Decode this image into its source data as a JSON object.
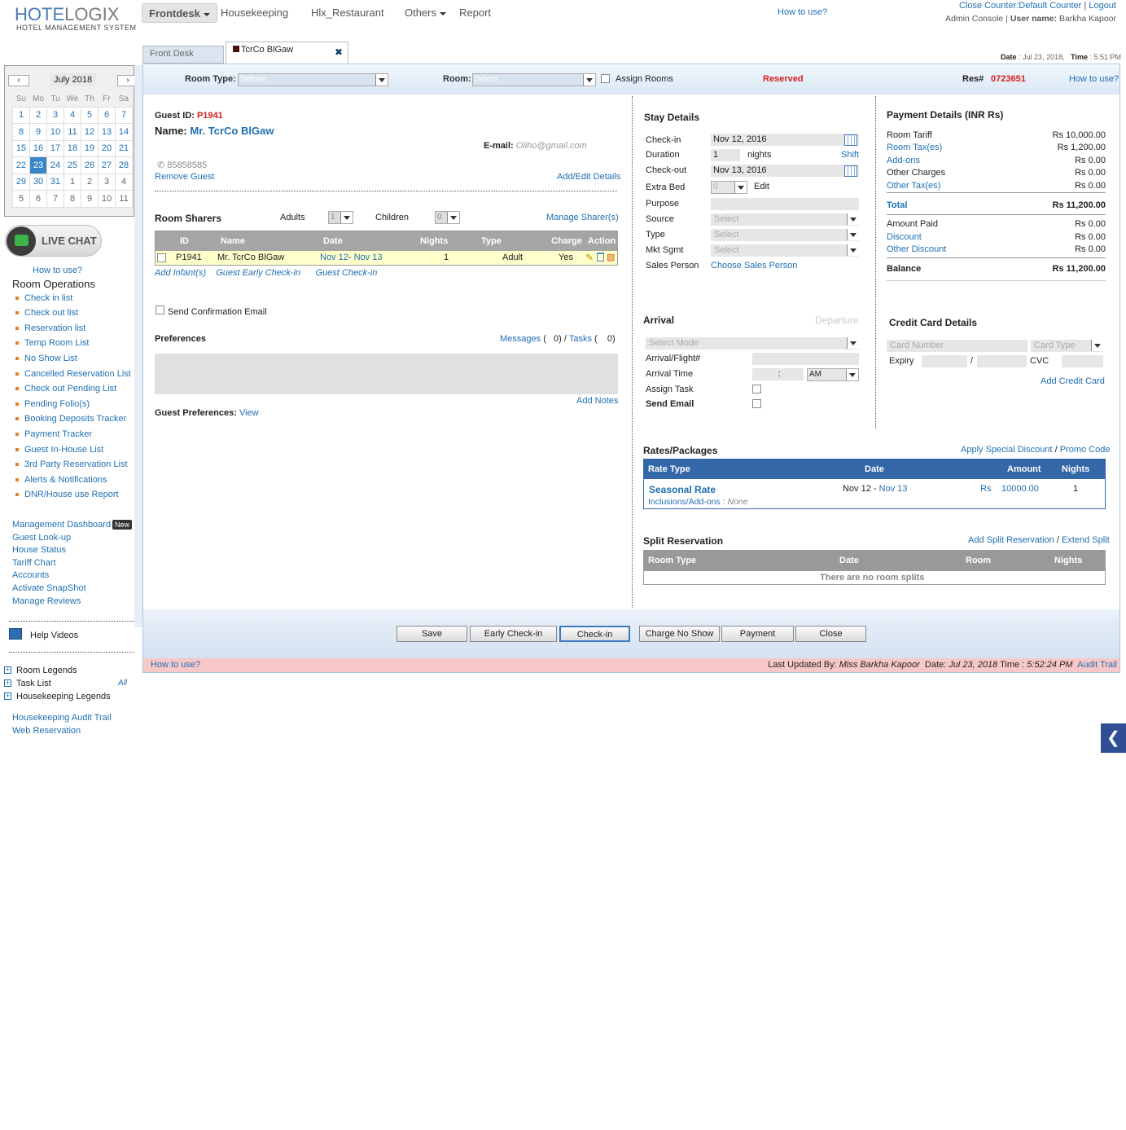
{
  "header": {
    "logo_main": "HOTELOGIX",
    "logo_a": "HOTE",
    "logo_b": "LOGIX",
    "logo_sub": "HOTEL MANAGEMENT SYSTEM",
    "nav": [
      "Frontdesk",
      "Housekeeping",
      "Hlx_Restaurant",
      "Others",
      "Report"
    ],
    "how_to_use": "How to use?",
    "close_counter": "Close Counter:Default Counter",
    "logout": "Logout",
    "admin_console": "Admin Console",
    "user_label": "User name:",
    "user_name": "Barkha Kapoor",
    "date_label": "Date",
    "date_value": ": Jul 23, 2018,",
    "time_label": "Time",
    "time_value": ": 5:51:PM"
  },
  "calendar": {
    "month": "July 2018",
    "days": [
      "Su",
      "Mo",
      "Tu",
      "We",
      "Th",
      "Fr",
      "Sa"
    ],
    "weeks": [
      [
        "1",
        "2",
        "3",
        "4",
        "5",
        "6",
        "7"
      ],
      [
        "8",
        "9",
        "10",
        "11",
        "12",
        "13",
        "14"
      ],
      [
        "15",
        "16",
        "17",
        "18",
        "19",
        "20",
        "21"
      ],
      [
        "22",
        "23",
        "24",
        "25",
        "26",
        "27",
        "28"
      ],
      [
        "29",
        "30",
        "31",
        "1",
        "2",
        "3",
        "4"
      ],
      [
        "5",
        "6",
        "7",
        "8",
        "9",
        "10",
        "11"
      ]
    ],
    "today": "23"
  },
  "sidebar": {
    "live_chat": "LIVE CHAT",
    "how_to_use": "How to use?",
    "room_ops_title": "Room Operations",
    "room_ops": [
      "Check in list",
      "Check out list",
      "Reservation list",
      "Temp Room List",
      "No Show List",
      "Cancelled Reservation List",
      "Check out Pending List",
      "Pending Folio(s)",
      "Booking Deposits Tracker",
      "Payment Tracker",
      "Guest In-House List",
      "3rd Party Reservation List",
      "Alerts & Notifications",
      "DNR/House use Report"
    ],
    "links": [
      "Management Dashboard",
      "Guest Look-up",
      "House Status",
      "Tariff Chart",
      "Accounts",
      "Activate SnapShot",
      "Manage Reviews"
    ],
    "new_badge": "New",
    "help_videos": "Help Videos",
    "legends": [
      "Room Legends",
      "Task List",
      "Housekeeping Legends"
    ],
    "task_all": "All",
    "bottom_links": [
      "Housekeeping Audit Trail",
      "Web Reservation"
    ]
  },
  "tabs": {
    "front_desk": "Front Desk",
    "guest_tab": "TcrCo BlGaw",
    "close": "✖"
  },
  "topbar": {
    "room_type_label": "Room Type:",
    "room_type_value": "Deluxe",
    "room_label": "Room:",
    "room_value": "Select",
    "assign_rooms": "Assign Rooms",
    "status": "Reserved",
    "res_label": "Res#",
    "res_no": "0723651",
    "how_to_use": "How to use?"
  },
  "guest": {
    "id_label": "Guest ID:",
    "id": "P1941",
    "name_label": "Name:",
    "name": "Mr. TcrCo BlGaw",
    "email_label": "E-mail:",
    "email": "Oliho@gmail.com",
    "phone": "85858585",
    "remove": "Remove Guest",
    "add_edit": "Add/Edit Details"
  },
  "sharers": {
    "title": "Room Sharers",
    "adults_label": "Adults",
    "adults": "1",
    "children_label": "Children",
    "children": "0",
    "manage": "Manage Sharer(s)",
    "cols": [
      "ID",
      "Name",
      "Date",
      "Nights",
      "Type",
      "Charge",
      "Action"
    ],
    "row": {
      "id": "P1941",
      "name": "Mr. TcrCo BlGaw",
      "date_from": "Nov 12",
      "date_sep": "-",
      "date_to": "Nov 13",
      "nights": "1",
      "type": "Adult",
      "charge": "Yes"
    },
    "add_infant": "Add Infant(s)",
    "early_checkin": "Guest Early Check-in",
    "guest_checkin": "Guest Check-in"
  },
  "confirmation": "Send Confirmation Email",
  "preferences": {
    "title": "Preferences",
    "messages": "Messages",
    "msg_count": "0",
    "tasks": "Tasks",
    "task_count": "0",
    "open": "(",
    "close": ")",
    "slash": "/",
    "add_notes": "Add Notes",
    "guest_pref_label": "Guest Preferences:",
    "view": "View"
  },
  "stay": {
    "title": "Stay Details",
    "checkin_label": "Check-in",
    "checkin": "Nov 12, 2016",
    "duration_label": "Duration",
    "duration": "1",
    "nights": "nights",
    "shift": "Shift",
    "checkout_label": "Check-out",
    "checkout": "Nov 13, 2016",
    "extra_bed_label": "Extra Bed",
    "extra_bed": "0",
    "edit": "Edit",
    "purpose_label": "Purpose",
    "source_label": "Source",
    "type_label": "Type",
    "mkt_label": "Mkt Sgmt",
    "select": "Select",
    "sales_label": "Sales Person",
    "sales": "Choose Sales Person"
  },
  "arrival": {
    "title": "Arrival",
    "departure": "Departure",
    "mode": "Select Mode",
    "flight_label": "Arrival/Flight#",
    "time_label": "Arrival Time",
    "time_sep": ":",
    "ampm": "AM",
    "task_label": "Assign Task",
    "email_label": "Send Email"
  },
  "payment": {
    "title": "Payment Details (INR Rs)",
    "rows": [
      {
        "label": "Room Tariff",
        "value": "Rs 10,000.00",
        "link": false
      },
      {
        "label": "Room Tax(es)",
        "value": "Rs 1,200.00",
        "link": true
      },
      {
        "label": "Add-ons",
        "value": "Rs 0.00",
        "link": true
      },
      {
        "label": "Other Charges",
        "value": "Rs 0.00",
        "link": false
      },
      {
        "label": "Other Tax(es)",
        "value": "Rs 0.00",
        "link": true
      }
    ],
    "total_label": "Total",
    "total": "Rs 11,200.00",
    "rows2": [
      {
        "label": "Amount Paid",
        "value": "Rs 0.00",
        "link": false
      },
      {
        "label": "Discount",
        "value": "Rs 0.00",
        "link": true
      },
      {
        "label": "Other Discount",
        "value": "Rs 0.00",
        "link": true
      }
    ],
    "balance_label": "Balance",
    "balance": "Rs 11,200.00"
  },
  "card": {
    "title": "Credit Card Details",
    "number": "Card Number",
    "type": "Card Type",
    "expiry": "Expiry",
    "slash": "/",
    "cvc": "CVC",
    "add": "Add Credit Card"
  },
  "rates": {
    "title": "Rates/Packages",
    "special": "Apply Special Discount",
    "slash": "/",
    "promo": "Promo Code",
    "cols": [
      "Rate Type",
      "Date",
      "Amount",
      "Nights"
    ],
    "row": {
      "rate": "Seasonal Rate",
      "date_from": "Nov 12 -",
      "date_to": "Nov 13",
      "currency": "Rs",
      "amount": "10000.00",
      "nights": "1",
      "incl_label": "Inclusions/Add-ons :",
      "incl": "None"
    }
  },
  "split": {
    "title": "Split Reservation",
    "add": "Add Split Reservation",
    "slash": "/",
    "extend": "Extend Split",
    "cols": [
      "Room Type",
      "Date",
      "Room",
      "Nights"
    ],
    "empty": "There are no room splits"
  },
  "buttons": [
    "Save",
    "Early Check-in",
    "Check-in",
    "Charge No Show",
    "Payment",
    "Close"
  ],
  "footer": {
    "how_to_use": "How to use?",
    "updated_label": "Last Updated By:",
    "updated_by": "Miss Barkha Kapoor",
    "date_label": "Date:",
    "date": "Jul 23, 2018",
    "time_label": "Time :",
    "time": "5:52:24 PM",
    "audit": "Audit Trail"
  },
  "collapse": "❮"
}
